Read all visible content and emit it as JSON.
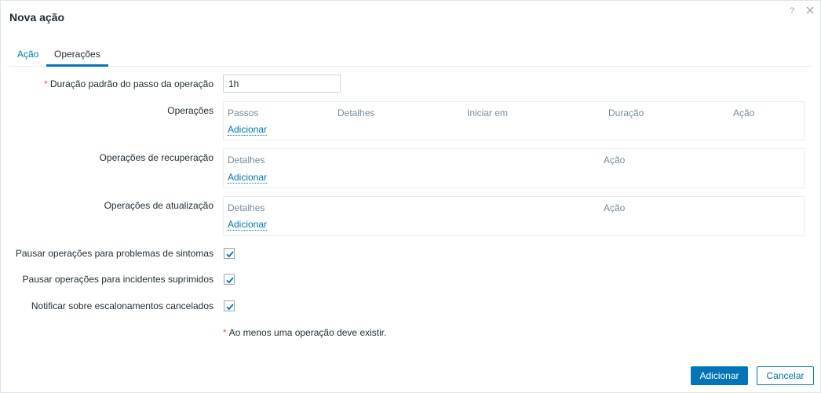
{
  "dialog": {
    "title": "Nova ação",
    "help_glyph": "?",
    "icons": {
      "help": "help-icon",
      "close": "close-icon",
      "check": "check-icon"
    }
  },
  "tabs": [
    {
      "label": "Ação",
      "active": false
    },
    {
      "label": "Operações",
      "active": true
    }
  ],
  "form": {
    "step_duration": {
      "required_marker": "*",
      "label": "Duração padrão do passo da operação",
      "value": "1h"
    },
    "operations": {
      "label": "Operações",
      "columns": [
        "Passos",
        "Detalhes",
        "Iniciar em",
        "Duração",
        "Ação"
      ],
      "add_label": "Adicionar"
    },
    "recovery_operations": {
      "label": "Operações de recuperação",
      "columns": [
        "Detalhes",
        "Ação"
      ],
      "add_label": "Adicionar"
    },
    "update_operations": {
      "label": "Operações de atualização",
      "columns": [
        "Detalhes",
        "Ação"
      ],
      "add_label": "Adicionar"
    },
    "checkboxes": [
      {
        "label": "Pausar operações para problemas de sintomas",
        "checked": true
      },
      {
        "label": "Pausar operações para incidentes suprimidos",
        "checked": true
      },
      {
        "label": "Notificar sobre escalonamentos cancelados",
        "checked": true
      }
    ],
    "note": {
      "required_marker": "*",
      "text": "Ao menos uma operação deve existir."
    }
  },
  "buttons": {
    "add": "Adicionar",
    "cancel": "Cancelar"
  },
  "colors": {
    "accent": "#0275b8",
    "required": "#e45959",
    "muted": "#768d99"
  }
}
